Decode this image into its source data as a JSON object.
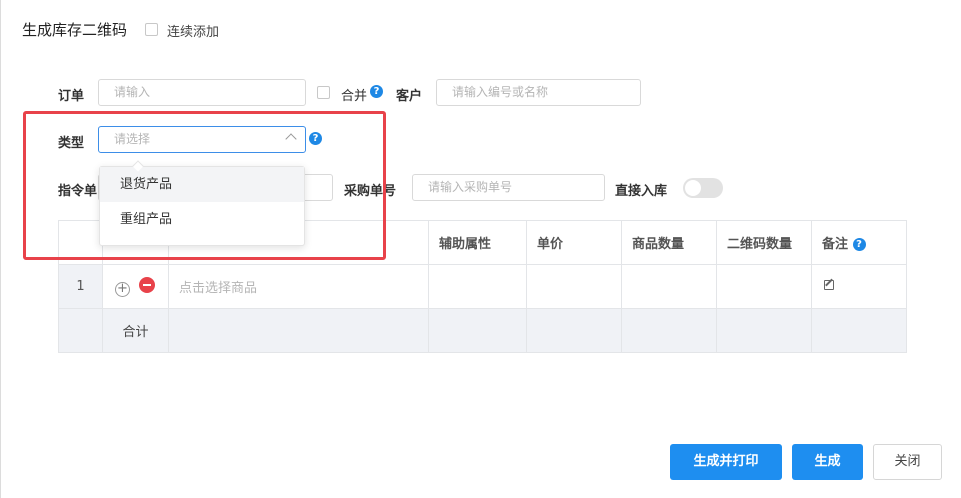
{
  "dialog": {
    "title": "生成库存二维码",
    "continuous_add_label": "连续添加"
  },
  "form": {
    "order_label": "订单",
    "order_placeholder": "请输入",
    "merge_label": "合并",
    "customer_label": "客户",
    "customer_placeholder": "请输入编号或名称",
    "type_label": "类型",
    "type_placeholder": "请选择",
    "directive_label": "指令单",
    "purchase_label": "采购单号",
    "purchase_placeholder": "请输入采购单号",
    "direct_stock_label": "直接入库",
    "direct_stock_on": false
  },
  "type_dropdown": {
    "options": [
      "退货产品",
      "重组产品"
    ],
    "hovered_index": 0
  },
  "table": {
    "headers": [
      "",
      "",
      "",
      "辅助属性",
      "单价",
      "商品数量",
      "二维码数量",
      "备注"
    ],
    "rows": [
      {
        "index": "1",
        "product_placeholder": "点击选择商品"
      }
    ],
    "total_label": "合计"
  },
  "buttons": {
    "generate_print": "生成并打印",
    "generate": "生成",
    "close": "关闭"
  },
  "colors": {
    "primary": "#1e8ef0",
    "highlight_box": "#e8424a",
    "help_icon": "#1e88e5",
    "remove_icon": "#e8424a"
  }
}
